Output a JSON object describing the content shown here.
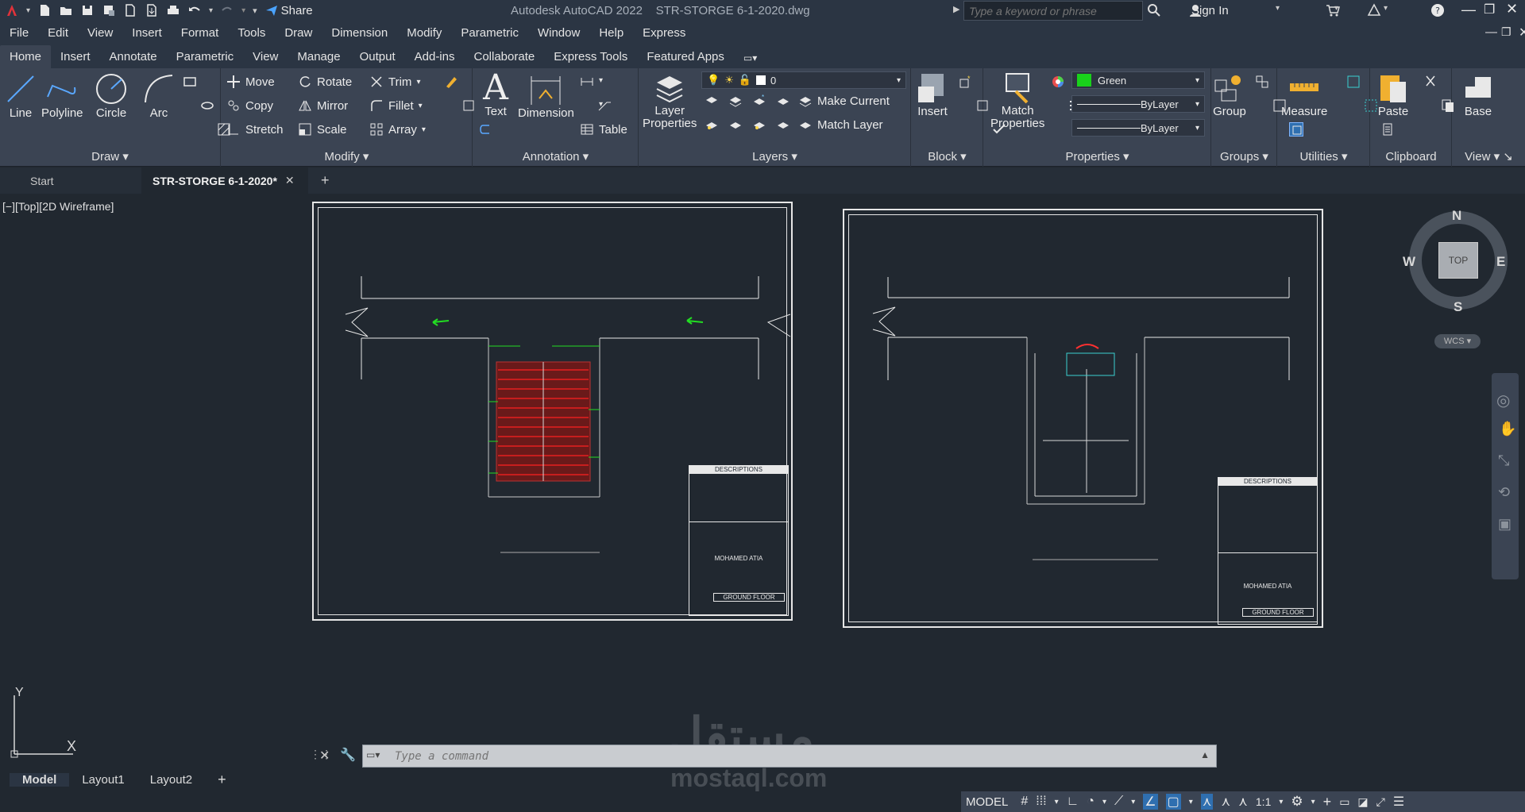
{
  "title": {
    "app": "Autodesk AutoCAD 2022",
    "file": "STR-STORGE 6-1-2020.dwg",
    "share": "Share",
    "search_placeholder": "Type a keyword or phrase",
    "sign_in": "Sign In"
  },
  "menu": [
    "File",
    "Edit",
    "View",
    "Insert",
    "Format",
    "Tools",
    "Draw",
    "Dimension",
    "Modify",
    "Parametric",
    "Window",
    "Help",
    "Express"
  ],
  "ribbon_tabs": [
    "Home",
    "Insert",
    "Annotate",
    "Parametric",
    "View",
    "Manage",
    "Output",
    "Add-ins",
    "Collaborate",
    "Express Tools",
    "Featured Apps"
  ],
  "draw": {
    "title": "Draw",
    "line": "Line",
    "polyline": "Polyline",
    "circle": "Circle",
    "arc": "Arc"
  },
  "modify": {
    "title": "Modify",
    "move": "Move",
    "rotate": "Rotate",
    "trim": "Trim",
    "copy": "Copy",
    "mirror": "Mirror",
    "fillet": "Fillet",
    "stretch": "Stretch",
    "scale": "Scale",
    "array": "Array"
  },
  "annotation": {
    "title": "Annotation",
    "text": "Text",
    "dimension": "Dimension",
    "table": "Table"
  },
  "layers": {
    "title": "Layers",
    "layer_properties": "Layer\nProperties",
    "current_layer": "0",
    "make_current": "Make Current",
    "match_layer": "Match Layer"
  },
  "block": {
    "title": "Block",
    "insert": "Insert"
  },
  "properties": {
    "title": "Properties",
    "match": "Match\nProperties",
    "color": "Green",
    "linetype": "ByLayer",
    "lineweight": "ByLayer",
    "color_hex": "#19d11b"
  },
  "groups": {
    "title": "Groups",
    "group": "Group"
  },
  "utilities": {
    "title": "Utilities",
    "measure": "Measure"
  },
  "clipboard": {
    "title": "Clipboard",
    "paste": "Paste"
  },
  "view": {
    "title": "View",
    "base": "Base"
  },
  "doc_tabs": {
    "start": "Start",
    "active": "STR-STORGE 6-1-2020*"
  },
  "viewport_label": "[−][Top][2D Wireframe]",
  "viewcube": {
    "n": "N",
    "s": "S",
    "e": "E",
    "w": "W",
    "top": "TOP",
    "wcs": "WCS"
  },
  "sheet1": {
    "descriptions": "DESCRIPTIONS",
    "name": "MOHAMED ATIA",
    "floor": "GROUND FLOOR"
  },
  "sheet2": {
    "descriptions": "DESCRIPTIONS",
    "name": "MOHAMED ATIA",
    "floor": "GROUND FLOOR"
  },
  "ucs": {
    "y": "Y",
    "x": "X"
  },
  "command": {
    "placeholder": "Type a command"
  },
  "layout_tabs": [
    "Model",
    "Layout1",
    "Layout2"
  ],
  "status": {
    "model": "MODEL",
    "scale": "1:1"
  },
  "watermark": {
    "arabic": "مستقل",
    "latin": "mostaql.com"
  }
}
